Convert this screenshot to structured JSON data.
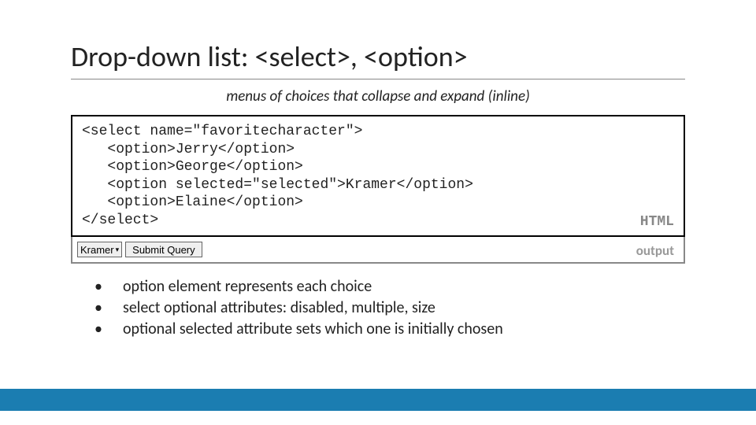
{
  "title": "Drop-down list: <select>, <option>",
  "subtitle": "menus of choices that collapse and expand (inline)",
  "code": {
    "line1": "<select name=\"favoritecharacter\">",
    "line2": "   <option>Jerry</option>",
    "line3": "   <option>George</option>",
    "line4": "   <option selected=\"selected\">Kramer</option>",
    "line5": "   <option>Elaine</option>",
    "line6": "</select>",
    "label": "HTML"
  },
  "output": {
    "selected": "Kramer",
    "button": "Submit Query",
    "label": "output"
  },
  "bullets": {
    "b1": "option element represents each choice",
    "b2": "select optional attributes: disabled, multiple, size",
    "b3": "optional selected attribute sets which one is initially chosen"
  }
}
